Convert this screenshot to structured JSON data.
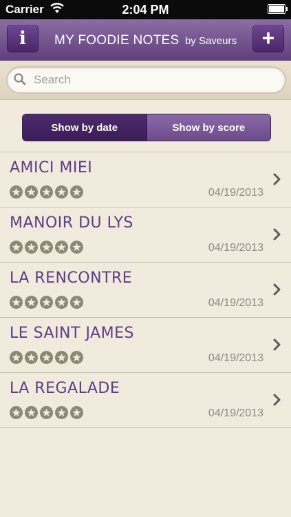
{
  "status": {
    "carrier": "Carrier",
    "time": "2:04 PM",
    "battery": 0.92
  },
  "nav": {
    "title": "MY FOODIE NOTES",
    "subtitle": "by Saveurs",
    "info_label": "i",
    "add_label": "+"
  },
  "search": {
    "placeholder": "Search",
    "value": ""
  },
  "segments": {
    "by_date": "Show by date",
    "by_score": "Show by score",
    "selected": "by_date"
  },
  "colors": {
    "accent": "#5e3c86",
    "nav_bar": "#6f4f8e",
    "background": "#f1ebdd",
    "star": "#8d8777"
  },
  "restaurants": [
    {
      "name": "AMICI MIEI",
      "date": "04/19/2013",
      "rating": 0
    },
    {
      "name": "MANOIR DU LYS",
      "date": "04/19/2013",
      "rating": 0
    },
    {
      "name": "LA RENCONTRE",
      "date": "04/19/2013",
      "rating": 0
    },
    {
      "name": "LE SAINT JAMES",
      "date": "04/19/2013",
      "rating": 0
    },
    {
      "name": "LA REGALADE",
      "date": "04/19/2013",
      "rating": 0
    }
  ]
}
